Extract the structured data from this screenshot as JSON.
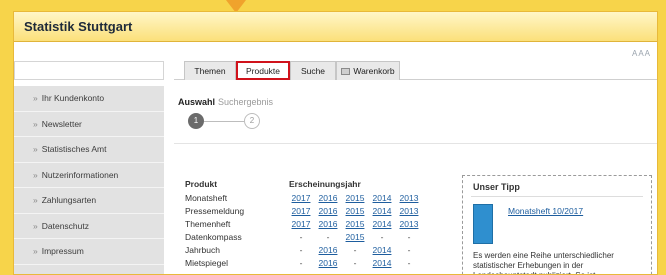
{
  "header": {
    "title": "Statistik Stuttgart",
    "font_size_control": "AAA"
  },
  "sidebar": {
    "items": [
      {
        "label": "Ihr Kundenkonto"
      },
      {
        "label": "Newsletter"
      },
      {
        "label": "Statistisches Amt"
      },
      {
        "label": "Nutzerinformationen"
      },
      {
        "label": "Zahlungsarten"
      },
      {
        "label": "Datenschutz"
      },
      {
        "label": "Impressum"
      }
    ]
  },
  "tabs": [
    {
      "label": "Themen"
    },
    {
      "label": "Produkte",
      "active": true
    },
    {
      "label": "Suche"
    },
    {
      "label": "Warenkorb"
    }
  ],
  "steps": {
    "current_label": "Auswahl",
    "next_label": "Suchergebnis",
    "step1": "1",
    "step2": "2"
  },
  "table": {
    "col_product": "Produkt",
    "col_year": "Erscheinungsjahr",
    "rows": [
      {
        "name": "Monatsheft",
        "years": [
          "2017",
          "2016",
          "2015",
          "2014",
          "2013"
        ]
      },
      {
        "name": "Pressemeldung",
        "years": [
          "2017",
          "2016",
          "2015",
          "2014",
          "2013"
        ]
      },
      {
        "name": "Themenheft",
        "years": [
          "2017",
          "2016",
          "2015",
          "2014",
          "2013"
        ]
      },
      {
        "name": "Datenkompass",
        "years": [
          "-",
          "-",
          "2015",
          "-",
          "-"
        ]
      },
      {
        "name": "Jahrbuch",
        "years": [
          "-",
          "2016",
          "-",
          "2014",
          "-"
        ]
      },
      {
        "name": "Mietspiegel",
        "years": [
          "-",
          "2016",
          "-",
          "2014",
          "-"
        ]
      }
    ]
  },
  "tipp": {
    "title": "Unser Tipp",
    "link": "Monatsheft 10/2017",
    "text": "Es werden eine Reihe unterschiedlicher statistischer Erhebungen in der Landeshauptstadt publiziert. So ist"
  },
  "colors": {
    "accent": "#f7d44a",
    "active_tab_border": "#d0121b",
    "link": "#1d5d9e"
  }
}
